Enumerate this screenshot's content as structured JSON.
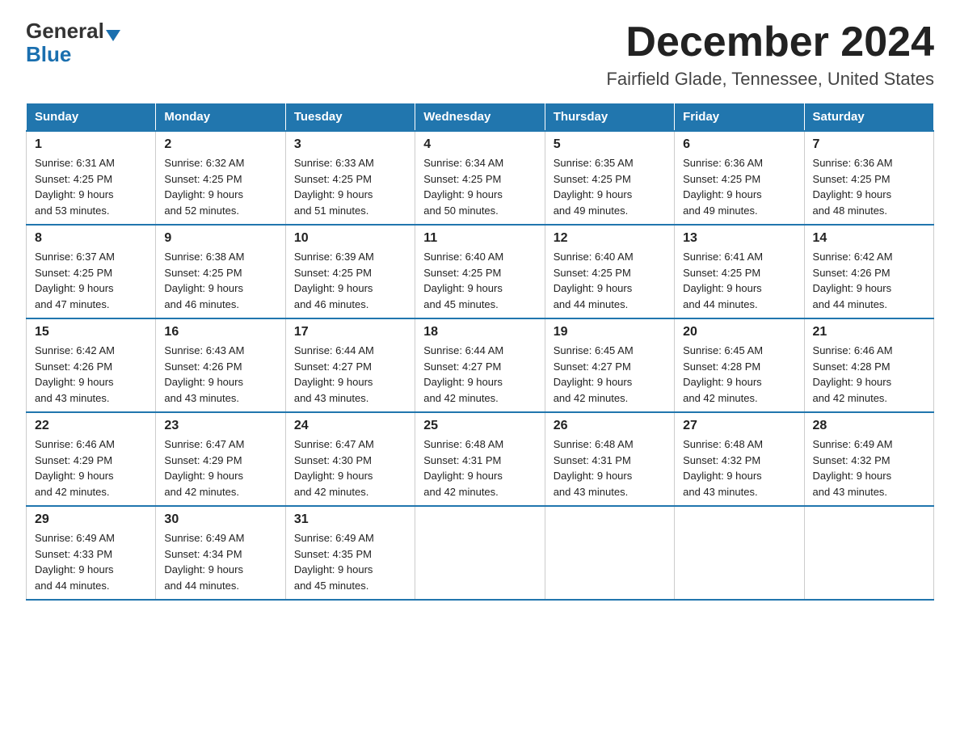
{
  "logo": {
    "general": "General",
    "blue": "Blue"
  },
  "header": {
    "title": "December 2024",
    "subtitle": "Fairfield Glade, Tennessee, United States"
  },
  "weekdays": [
    "Sunday",
    "Monday",
    "Tuesday",
    "Wednesday",
    "Thursday",
    "Friday",
    "Saturday"
  ],
  "weeks": [
    [
      {
        "day": "1",
        "sunrise": "6:31 AM",
        "sunset": "4:25 PM",
        "daylight": "9 hours and 53 minutes."
      },
      {
        "day": "2",
        "sunrise": "6:32 AM",
        "sunset": "4:25 PM",
        "daylight": "9 hours and 52 minutes."
      },
      {
        "day": "3",
        "sunrise": "6:33 AM",
        "sunset": "4:25 PM",
        "daylight": "9 hours and 51 minutes."
      },
      {
        "day": "4",
        "sunrise": "6:34 AM",
        "sunset": "4:25 PM",
        "daylight": "9 hours and 50 minutes."
      },
      {
        "day": "5",
        "sunrise": "6:35 AM",
        "sunset": "4:25 PM",
        "daylight": "9 hours and 49 minutes."
      },
      {
        "day": "6",
        "sunrise": "6:36 AM",
        "sunset": "4:25 PM",
        "daylight": "9 hours and 49 minutes."
      },
      {
        "day": "7",
        "sunrise": "6:36 AM",
        "sunset": "4:25 PM",
        "daylight": "9 hours and 48 minutes."
      }
    ],
    [
      {
        "day": "8",
        "sunrise": "6:37 AM",
        "sunset": "4:25 PM",
        "daylight": "9 hours and 47 minutes."
      },
      {
        "day": "9",
        "sunrise": "6:38 AM",
        "sunset": "4:25 PM",
        "daylight": "9 hours and 46 minutes."
      },
      {
        "day": "10",
        "sunrise": "6:39 AM",
        "sunset": "4:25 PM",
        "daylight": "9 hours and 46 minutes."
      },
      {
        "day": "11",
        "sunrise": "6:40 AM",
        "sunset": "4:25 PM",
        "daylight": "9 hours and 45 minutes."
      },
      {
        "day": "12",
        "sunrise": "6:40 AM",
        "sunset": "4:25 PM",
        "daylight": "9 hours and 44 minutes."
      },
      {
        "day": "13",
        "sunrise": "6:41 AM",
        "sunset": "4:25 PM",
        "daylight": "9 hours and 44 minutes."
      },
      {
        "day": "14",
        "sunrise": "6:42 AM",
        "sunset": "4:26 PM",
        "daylight": "9 hours and 44 minutes."
      }
    ],
    [
      {
        "day": "15",
        "sunrise": "6:42 AM",
        "sunset": "4:26 PM",
        "daylight": "9 hours and 43 minutes."
      },
      {
        "day": "16",
        "sunrise": "6:43 AM",
        "sunset": "4:26 PM",
        "daylight": "9 hours and 43 minutes."
      },
      {
        "day": "17",
        "sunrise": "6:44 AM",
        "sunset": "4:27 PM",
        "daylight": "9 hours and 43 minutes."
      },
      {
        "day": "18",
        "sunrise": "6:44 AM",
        "sunset": "4:27 PM",
        "daylight": "9 hours and 42 minutes."
      },
      {
        "day": "19",
        "sunrise": "6:45 AM",
        "sunset": "4:27 PM",
        "daylight": "9 hours and 42 minutes."
      },
      {
        "day": "20",
        "sunrise": "6:45 AM",
        "sunset": "4:28 PM",
        "daylight": "9 hours and 42 minutes."
      },
      {
        "day": "21",
        "sunrise": "6:46 AM",
        "sunset": "4:28 PM",
        "daylight": "9 hours and 42 minutes."
      }
    ],
    [
      {
        "day": "22",
        "sunrise": "6:46 AM",
        "sunset": "4:29 PM",
        "daylight": "9 hours and 42 minutes."
      },
      {
        "day": "23",
        "sunrise": "6:47 AM",
        "sunset": "4:29 PM",
        "daylight": "9 hours and 42 minutes."
      },
      {
        "day": "24",
        "sunrise": "6:47 AM",
        "sunset": "4:30 PM",
        "daylight": "9 hours and 42 minutes."
      },
      {
        "day": "25",
        "sunrise": "6:48 AM",
        "sunset": "4:31 PM",
        "daylight": "9 hours and 42 minutes."
      },
      {
        "day": "26",
        "sunrise": "6:48 AM",
        "sunset": "4:31 PM",
        "daylight": "9 hours and 43 minutes."
      },
      {
        "day": "27",
        "sunrise": "6:48 AM",
        "sunset": "4:32 PM",
        "daylight": "9 hours and 43 minutes."
      },
      {
        "day": "28",
        "sunrise": "6:49 AM",
        "sunset": "4:32 PM",
        "daylight": "9 hours and 43 minutes."
      }
    ],
    [
      {
        "day": "29",
        "sunrise": "6:49 AM",
        "sunset": "4:33 PM",
        "daylight": "9 hours and 44 minutes."
      },
      {
        "day": "30",
        "sunrise": "6:49 AM",
        "sunset": "4:34 PM",
        "daylight": "9 hours and 44 minutes."
      },
      {
        "day": "31",
        "sunrise": "6:49 AM",
        "sunset": "4:35 PM",
        "daylight": "9 hours and 45 minutes."
      },
      null,
      null,
      null,
      null
    ]
  ],
  "labels": {
    "sunrise": "Sunrise:",
    "sunset": "Sunset:",
    "daylight": "Daylight:"
  }
}
